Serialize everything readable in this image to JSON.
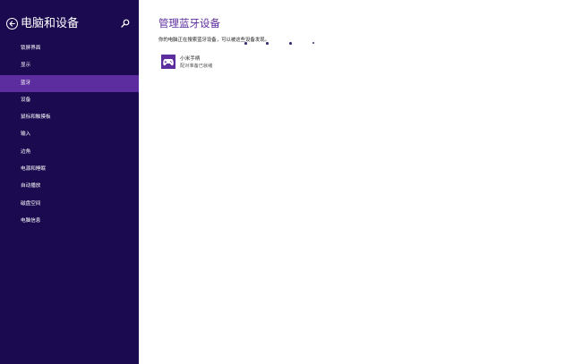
{
  "sidebar": {
    "title": "电脑和设备",
    "back_icon": "back-arrow-icon",
    "search_icon": "search-icon",
    "background": "#1b0a50",
    "selected_background": "#5c2d9e",
    "items": [
      {
        "label": "锁屏界面"
      },
      {
        "label": "显示"
      },
      {
        "label": "蓝牙",
        "selected": true
      },
      {
        "label": "设备"
      },
      {
        "label": "鼠标和触摸板"
      },
      {
        "label": "输入"
      },
      {
        "label": "边角"
      },
      {
        "label": "电源和睡眠"
      },
      {
        "label": "自动播放"
      },
      {
        "label": "磁盘空间"
      },
      {
        "label": "电脑信息"
      }
    ]
  },
  "main": {
    "title": "管理蓝牙设备",
    "title_color": "#5c2d9e",
    "status_text": "你的电脑正在搜索蓝牙设备，可以被这些设备发现。",
    "devices": [
      {
        "name": "小米手柄",
        "status": "配对准备已就绪",
        "icon": "gamepad-icon"
      }
    ]
  }
}
